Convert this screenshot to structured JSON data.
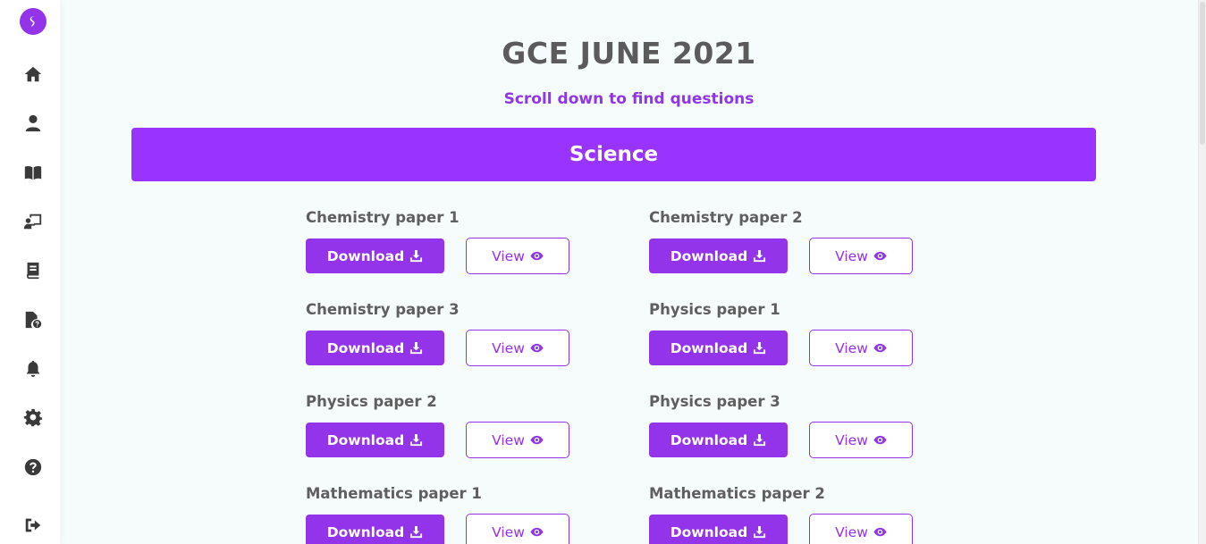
{
  "page": {
    "title": "GCE JUNE 2021",
    "subtitle": "Scroll down to find questions"
  },
  "sidebar": {
    "logo_icon": "brand-s-logo",
    "items": [
      {
        "icon": "home-icon"
      },
      {
        "icon": "user-icon"
      },
      {
        "icon": "book-open-icon"
      },
      {
        "icon": "teacher-board-icon"
      },
      {
        "icon": "book-icon"
      },
      {
        "icon": "file-question-icon"
      },
      {
        "icon": "bell-icon"
      },
      {
        "icon": "gear-icon"
      },
      {
        "icon": "help-circle-icon"
      },
      {
        "icon": "logout-icon"
      }
    ]
  },
  "section": {
    "title": "Science"
  },
  "papers": [
    {
      "name": "Chemistry paper 1",
      "download_label": "Download",
      "view_label": "View"
    },
    {
      "name": "Chemistry paper 2",
      "download_label": "Download",
      "view_label": "View"
    },
    {
      "name": "Chemistry paper 3",
      "download_label": "Download",
      "view_label": "View"
    },
    {
      "name": "Physics paper 1",
      "download_label": "Download",
      "view_label": "View"
    },
    {
      "name": "Physics paper 2",
      "download_label": "Download",
      "view_label": "View"
    },
    {
      "name": "Physics paper 3",
      "download_label": "Download",
      "view_label": "View"
    },
    {
      "name": "Mathematics paper 1",
      "download_label": "Download",
      "view_label": "View"
    },
    {
      "name": "Mathematics paper 2",
      "download_label": "Download",
      "view_label": "View"
    }
  ],
  "colors": {
    "accent": "#9333ea",
    "section_bar": "#9933ff",
    "heading_text": "#5b5b5b",
    "background": "#f6fcfc"
  }
}
